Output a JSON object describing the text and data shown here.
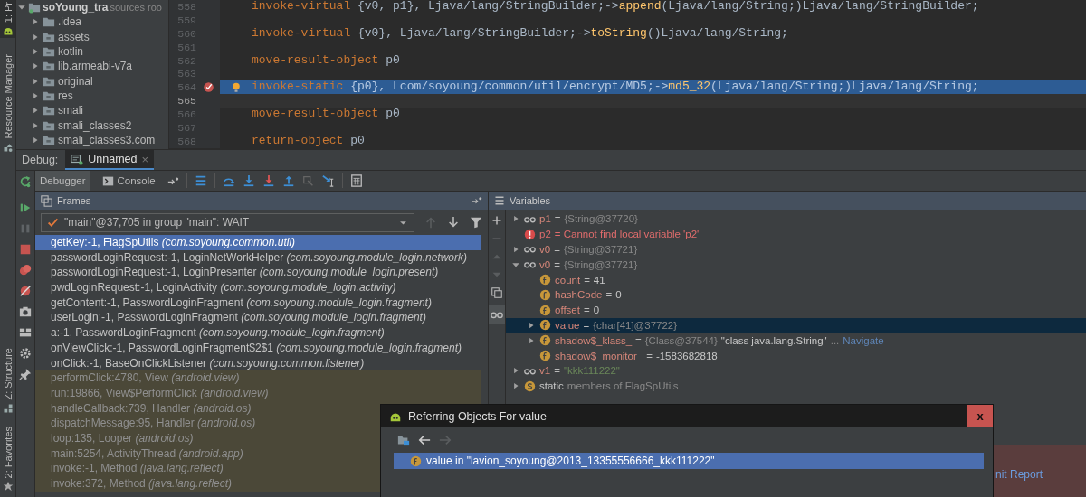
{
  "tool_stripe": [
    {
      "label": "1: Pr",
      "selected": true,
      "kind": "project"
    },
    {
      "label": "Resource Manager",
      "selected": false,
      "kind": "resources"
    },
    {
      "label": "Z: Structure",
      "selected": false,
      "kind": "structure"
    },
    {
      "label": "2: Favorites",
      "selected": false,
      "kind": "favorites"
    }
  ],
  "project": {
    "root": {
      "name": "soYoung_tra",
      "hint": "sources roo",
      "expanded": true
    },
    "items": [
      {
        "name": ".idea",
        "kind": "folder",
        "expanded": false
      },
      {
        "name": "assets",
        "kind": "source",
        "expanded": false
      },
      {
        "name": "kotlin",
        "kind": "source",
        "expanded": false
      },
      {
        "name": "lib.armeabi-v7a",
        "kind": "source",
        "expanded": false
      },
      {
        "name": "original",
        "kind": "source",
        "expanded": false
      },
      {
        "name": "res",
        "kind": "source",
        "expanded": false
      },
      {
        "name": "smali",
        "kind": "source",
        "expanded": false
      },
      {
        "name": "smali_classes2",
        "kind": "source",
        "expanded": false
      },
      {
        "name": "smali_classes3.com",
        "kind": "source",
        "expanded": false
      }
    ]
  },
  "editor": {
    "lines": [
      {
        "number": "558",
        "breakpoint": false,
        "current": false,
        "caret": false,
        "bulb": false,
        "tokens": [
          {
            "kind": "keyword",
            "text": "invoke-virtual"
          },
          {
            "kind": "plain",
            "text": " {v0, p1}, Ljava/lang/StringBuilder;->"
          },
          {
            "kind": "method",
            "text": "append"
          },
          {
            "kind": "plain",
            "text": "(Ljava/lang/String;)Ljava/lang/StringBuilder;"
          }
        ]
      },
      {
        "number": "559",
        "breakpoint": false,
        "current": false,
        "caret": false,
        "bulb": false
      },
      {
        "number": "560",
        "breakpoint": false,
        "current": false,
        "caret": false,
        "bulb": false,
        "tokens": [
          {
            "kind": "keyword",
            "text": "invoke-virtual"
          },
          {
            "kind": "plain",
            "text": " {v0}, Ljava/lang/StringBuilder;->"
          },
          {
            "kind": "method",
            "text": "toString"
          },
          {
            "kind": "plain",
            "text": "()Ljava/lang/String;"
          }
        ]
      },
      {
        "number": "561",
        "breakpoint": false,
        "current": false,
        "caret": false,
        "bulb": false
      },
      {
        "number": "562",
        "breakpoint": false,
        "current": false,
        "caret": false,
        "bulb": false,
        "tokens": [
          {
            "kind": "keyword",
            "text": "move-result-object"
          },
          {
            "kind": "plain",
            "text": " p0"
          }
        ]
      },
      {
        "number": "563",
        "breakpoint": false,
        "current": false,
        "caret": false,
        "bulb": false
      },
      {
        "number": "564",
        "breakpoint": true,
        "current": true,
        "caret": false,
        "bulb": true,
        "tokens": [
          {
            "kind": "keyword",
            "text": "invoke-static"
          },
          {
            "kind": "plain",
            "text": " {p0}, Lcom/soyoung/common/util/encrypt/MD5;->"
          },
          {
            "kind": "method",
            "text": "md5_32"
          },
          {
            "kind": "plain",
            "text": "(Ljava/lang/String;)Ljava/lang/String;"
          }
        ]
      },
      {
        "number": "565",
        "breakpoint": false,
        "current": false,
        "caret": true,
        "bulb": false
      },
      {
        "number": "566",
        "breakpoint": false,
        "current": false,
        "caret": false,
        "bulb": false,
        "tokens": [
          {
            "kind": "keyword",
            "text": "move-result-object"
          },
          {
            "kind": "plain",
            "text": " p0"
          }
        ]
      },
      {
        "number": "567",
        "breakpoint": false,
        "current": false,
        "caret": false,
        "bulb": false
      },
      {
        "number": "568",
        "breakpoint": false,
        "current": false,
        "caret": false,
        "bulb": false,
        "tokens": [
          {
            "kind": "keyword",
            "text": "return-object"
          },
          {
            "kind": "plain",
            "text": " p0"
          }
        ]
      }
    ]
  },
  "debug": {
    "label": "Debug:",
    "tabs": [
      {
        "label": "Unnamed",
        "close": "×",
        "selected": true
      }
    ]
  },
  "toolbar": {
    "tabs": [
      {
        "label": "Debugger",
        "kind": "debugger",
        "selected": true
      },
      {
        "label": "Console",
        "kind": "console",
        "selected": false
      }
    ]
  },
  "frames": {
    "title": "Frames",
    "thread": "\"main\"@37,705 in group \"main\": WAIT",
    "rows": [
      {
        "text": "getKey:-1, FlagSpUtils *(com.soyoung.common.util)*",
        "kind": "app",
        "selected": true
      },
      {
        "text": "passwordLoginRequest:-1, LoginNetWorkHelper *(com.soyoung.module_login.network)*",
        "kind": "app",
        "selected": false
      },
      {
        "text": "passwordLoginRequest:-1, LoginPresenter *(com.soyoung.module_login.present)*",
        "kind": "app",
        "selected": false
      },
      {
        "text": "pwdLoginRequest:-1, LoginActivity *(com.soyoung.module_login.activity)*",
        "kind": "app",
        "selected": false
      },
      {
        "text": "getContent:-1, PasswordLoginFragment *(com.soyoung.module_login.fragment)*",
        "kind": "app",
        "selected": false
      },
      {
        "text": "userLogin:-1, PasswordLoginFragment *(com.soyoung.module_login.fragment)*",
        "kind": "app",
        "selected": false
      },
      {
        "text": "a:-1, PasswordLoginFragment *(com.soyoung.module_login.fragment)*",
        "kind": "app",
        "selected": false
      },
      {
        "text": "onViewClick:-1, PasswordLoginFragment$2$1 *(com.soyoung.module_login.fragment)*",
        "kind": "app",
        "selected": false
      },
      {
        "text": "onClick:-1, BaseOnClickListener *(com.soyoung.common.listener)*",
        "kind": "app",
        "selected": false
      },
      {
        "text": "performClick:4780, View *(android.view)*",
        "kind": "library",
        "selected": false
      },
      {
        "text": "run:19866, View$PerformClick *(android.view)*",
        "kind": "library",
        "selected": false
      },
      {
        "text": "handleCallback:739, Handler *(android.os)*",
        "kind": "library",
        "selected": false
      },
      {
        "text": "dispatchMessage:95, Handler *(android.os)*",
        "kind": "library",
        "selected": false
      },
      {
        "text": "loop:135, Looper *(android.os)*",
        "kind": "library",
        "selected": false
      },
      {
        "text": "main:5254, ActivityThread *(android.app)*",
        "kind": "library",
        "selected": false
      },
      {
        "text": "invoke:-1, Method *(java.lang.reflect)*",
        "kind": "library",
        "selected": false
      },
      {
        "text": "invoke:372, Method *(java.lang.reflect)*",
        "kind": "library",
        "selected": false
      }
    ]
  },
  "variables": {
    "title": "Variables",
    "items": [
      {
        "kind": "watch",
        "name": "p1",
        "expanded": false,
        "selected": false,
        "parts": [
          {
            "kind": "op",
            "text": "="
          },
          {
            "kind": "ref",
            "text": "{String@37720}"
          }
        ]
      },
      {
        "kind": "error",
        "name": "p2",
        "selected": false,
        "parts": [
          {
            "kind": "error",
            "text": "= Cannot find local variable 'p2'"
          }
        ]
      },
      {
        "kind": "watch",
        "name": "v0",
        "expanded": false,
        "selected": false,
        "parts": [
          {
            "kind": "op",
            "text": "="
          },
          {
            "kind": "ref",
            "text": "{String@37721}"
          }
        ]
      },
      {
        "kind": "watch",
        "name": "v0",
        "expanded": true,
        "selected": false,
        "parts": [
          {
            "kind": "op",
            "text": "="
          },
          {
            "kind": "ref",
            "text": "{String@37721}"
          }
        ],
        "children": [
          {
            "kind": "field",
            "name": "count",
            "selected": false,
            "parts": [
              {
                "kind": "op",
                "text": "="
              },
              {
                "kind": "number",
                "text": "41"
              }
            ]
          },
          {
            "kind": "field",
            "name": "hashCode",
            "selected": false,
            "parts": [
              {
                "kind": "op",
                "text": "="
              },
              {
                "kind": "number",
                "text": "0"
              }
            ]
          },
          {
            "kind": "field",
            "name": "offset",
            "selected": false,
            "parts": [
              {
                "kind": "op",
                "text": "="
              },
              {
                "kind": "number",
                "text": "0"
              }
            ]
          },
          {
            "kind": "field",
            "name": "value",
            "expanded": false,
            "selected": true,
            "parts": [
              {
                "kind": "op",
                "text": "="
              },
              {
                "kind": "ref",
                "text": "{char[41]@37722}"
              }
            ]
          },
          {
            "kind": "field",
            "name": "shadow$_klass_",
            "expanded": false,
            "selected": false,
            "parts": [
              {
                "kind": "op",
                "text": "="
              },
              {
                "kind": "ref",
                "text": "{Class@37544}"
              },
              {
                "kind": "number",
                "text": "\"class java.lang.String\""
              },
              {
                "kind": "ref",
                "text": "..."
              },
              {
                "kind": "link",
                "text": "Navigate"
              }
            ]
          },
          {
            "kind": "field",
            "name": "shadow$_monitor_",
            "selected": false,
            "parts": [
              {
                "kind": "op",
                "text": "="
              },
              {
                "kind": "number",
                "text": "-1583682818"
              }
            ]
          }
        ]
      },
      {
        "kind": "watch",
        "name": "v1",
        "expanded": false,
        "selected": false,
        "parts": [
          {
            "kind": "op",
            "text": "="
          },
          {
            "kind": "string",
            "text": "\"kkk111222\""
          }
        ]
      },
      {
        "kind": "static",
        "name": "static",
        "expanded": false,
        "selected": false,
        "parts": [
          {
            "kind": "ref",
            "text": "members of FlagSpUtils"
          }
        ]
      }
    ]
  },
  "notification": {
    "link": "nit Report"
  },
  "dialog": {
    "title": "Referring Objects For value",
    "close": "x",
    "rows": [
      {
        "text": "value in \"lavion_soyoung@2013_13355556666_kkk111222\"",
        "selected": true
      }
    ]
  }
}
